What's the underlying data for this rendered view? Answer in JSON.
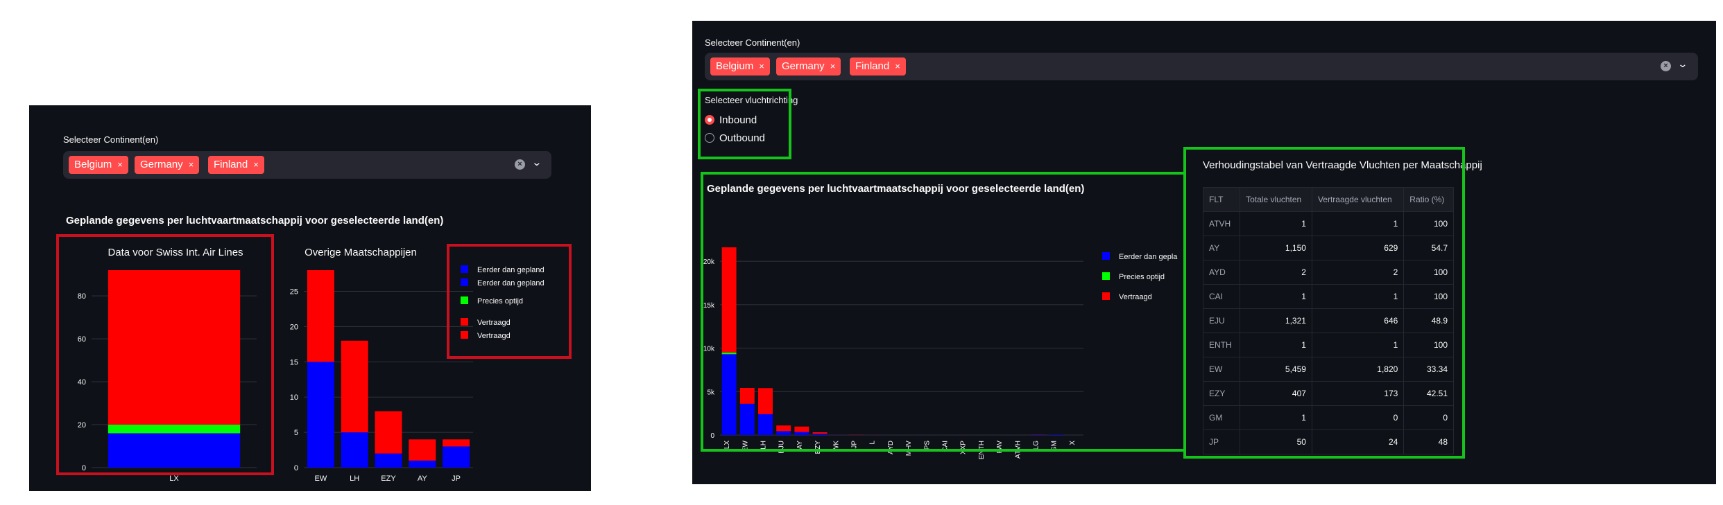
{
  "left_panel": {
    "select_label": "Selecteer Continent(en)",
    "tags": [
      "Belgium",
      "Germany",
      "Finland"
    ],
    "tag_remove_glyph": "×",
    "section_title": "Geplande gegevens per luchtvaartmaatschappij voor geselecteerde land(en)",
    "legend_labels": [
      "Eerder dan gepland",
      "Eerder dan gepland",
      "Precies optijd",
      "Vertraagd",
      "Vertraagd"
    ]
  },
  "right_panel": {
    "select_label": "Selecteer Continent(en)",
    "tags": [
      "Belgium",
      "Germany",
      "Finland"
    ],
    "tag_remove_glyph": "×",
    "direction_label": "Selecteer vluchtrichting",
    "direction_options": [
      "Inbound",
      "Outbound"
    ],
    "direction_selected": "Inbound",
    "section_title": "Geplande gegevens per luchtvaartmaatschappij voor geselecteerde land(en)",
    "legend_labels": [
      "Eerder dan geplan",
      "Precies optijd",
      "Vertraagd"
    ],
    "table_title": "Verhoudingstabel van Vertraagde Vluchten per Maatschappij",
    "table_headers": [
      "FLT",
      "Totale vluchten",
      "Vertraagde vluchten",
      "Ratio (%)"
    ],
    "table_rows": [
      [
        "ATVH",
        "1",
        "1",
        "100"
      ],
      [
        "AY",
        "1,150",
        "629",
        "54.7"
      ],
      [
        "AYD",
        "2",
        "2",
        "100"
      ],
      [
        "CAI",
        "1",
        "1",
        "100"
      ],
      [
        "EJU",
        "1,321",
        "646",
        "48.9"
      ],
      [
        "ENTH",
        "1",
        "1",
        "100"
      ],
      [
        "EW",
        "5,459",
        "1,820",
        "33.34"
      ],
      [
        "EZY",
        "407",
        "173",
        "42.51"
      ],
      [
        "GM",
        "1",
        "0",
        "0"
      ],
      [
        "JP",
        "50",
        "24",
        "48"
      ]
    ]
  },
  "colors": {
    "early": "#0000ff",
    "ontime": "#00ff00",
    "delayed": "#ff0000",
    "accent": "#ff4b4b",
    "background": "#0e1117",
    "highlight_red": "#c8101e",
    "highlight_green": "#16c21c"
  },
  "icons": {
    "clear": "x-circle-icon",
    "dropdown": "chevron-down-icon"
  },
  "chart_data": [
    {
      "type": "bar",
      "stacked": true,
      "title": "Data voor Swiss Int. Air Lines",
      "categories": [
        "LX"
      ],
      "series": [
        {
          "name": "Eerder dan gepland",
          "color": "#0000ff",
          "values": [
            16
          ]
        },
        {
          "name": "Precies optijd",
          "color": "#00ff00",
          "values": [
            4
          ]
        },
        {
          "name": "Vertraagd",
          "color": "#ff0000",
          "values": [
            72
          ]
        }
      ],
      "ylim": [
        0,
        92
      ],
      "yticks": [
        0,
        20,
        40,
        60,
        80
      ],
      "grid": true
    },
    {
      "type": "bar",
      "stacked": true,
      "title": "Overige Maatschappijen",
      "categories": [
        "EW",
        "LH",
        "EZY",
        "AY",
        "JP"
      ],
      "series": [
        {
          "name": "Eerder dan gepland",
          "color": "#0000ff",
          "values": [
            15,
            5,
            2,
            1,
            3
          ]
        },
        {
          "name": "Vertraagd",
          "color": "#ff0000",
          "values": [
            13,
            13,
            6,
            3,
            1
          ]
        }
      ],
      "ylim": [
        0,
        28
      ],
      "yticks": [
        0,
        5,
        10,
        15,
        20,
        25
      ],
      "grid": true,
      "legend_position": "right"
    },
    {
      "type": "bar",
      "stacked": true,
      "categories": [
        "LX",
        "EW",
        "LH",
        "EJU",
        "AY",
        "EZY",
        "WK",
        "JP",
        "L",
        "AYD",
        "MHV",
        "PS",
        "CAI",
        "XXP",
        "ENTH",
        "PAV",
        "ATVH",
        "LG",
        "GM",
        "X"
      ],
      "series": [
        {
          "name": "Eerder dan geplan",
          "color": "#0000ff",
          "values": [
            9300,
            3600,
            2400,
            450,
            350,
            150,
            20,
            20,
            10,
            0,
            0,
            0,
            0,
            0,
            0,
            0,
            0,
            50,
            60,
            0
          ]
        },
        {
          "name": "Precies optijd",
          "color": "#00ff00",
          "values": [
            200,
            0,
            0,
            0,
            0,
            0,
            0,
            0,
            0,
            0,
            0,
            0,
            0,
            0,
            0,
            0,
            0,
            0,
            0,
            0
          ]
        },
        {
          "name": "Vertraagd",
          "color": "#ff0000",
          "values": [
            12100,
            1820,
            3000,
            650,
            629,
            173,
            10,
            24,
            10,
            2,
            3,
            2,
            1,
            2,
            1,
            1,
            1,
            20,
            0,
            2
          ]
        }
      ],
      "ylim": [
        0,
        22000
      ],
      "yticks": [
        "0",
        "5k",
        "10k",
        "15k",
        "20k"
      ],
      "ytick_values": [
        0,
        5000,
        10000,
        15000,
        20000
      ],
      "grid": true,
      "legend_position": "right"
    }
  ]
}
